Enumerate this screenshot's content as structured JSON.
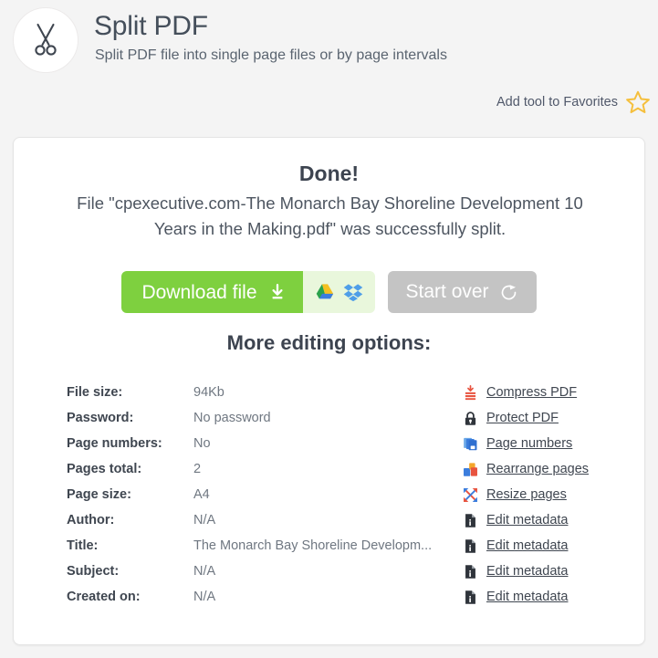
{
  "header": {
    "tool_icon": "scissors-icon",
    "title": "Split PDF",
    "subtitle": "Split PDF file into single page files or by page intervals",
    "favorites_label": "Add tool to Favorites",
    "favorites_icon": "star-outline-icon",
    "star_color": "#f5bf3c"
  },
  "result": {
    "done_title": "Done!",
    "message": "File \"cpexecutive.com-The Monarch Bay Shoreline Development 10 Years in the Making.pdf\" was successfully split."
  },
  "actions": {
    "download_label": "Download file",
    "download_icon": "download-icon",
    "download_color": "#7ed03f",
    "google_drive_icon": "google-drive-icon",
    "dropbox_icon": "dropbox-icon",
    "cloud_box_color": "#e9f7dc",
    "start_over_label": "Start over",
    "start_over_icon": "refresh-icon",
    "start_over_color": "#c4c4c4"
  },
  "more_options": {
    "heading": "More editing options:",
    "rows": [
      {
        "label": "File size:",
        "value": "94Kb",
        "link": "Compress PDF",
        "icon": "compress-icon"
      },
      {
        "label": "Password:",
        "value": "No password",
        "link": "Protect PDF",
        "icon": "lock-icon"
      },
      {
        "label": "Page numbers:",
        "value": "No",
        "link": "Page numbers",
        "icon": "page-numbers-icon"
      },
      {
        "label": "Pages total:",
        "value": "2",
        "link": "Rearrange pages",
        "icon": "rearrange-pages-icon"
      },
      {
        "label": "Page size:",
        "value": "A4",
        "link": "Resize pages",
        "icon": "resize-pages-icon"
      },
      {
        "label": "Author:",
        "value": "N/A",
        "link": "Edit metadata",
        "icon": "metadata-icon"
      },
      {
        "label": "Title:",
        "value": "The Monarch Bay Shoreline Developm...",
        "link": "Edit metadata",
        "icon": "metadata-icon"
      },
      {
        "label": "Subject:",
        "value": "N/A",
        "link": "Edit metadata",
        "icon": "metadata-icon"
      },
      {
        "label": "Created on:",
        "value": "N/A",
        "link": "Edit metadata",
        "icon": "metadata-icon"
      }
    ]
  }
}
